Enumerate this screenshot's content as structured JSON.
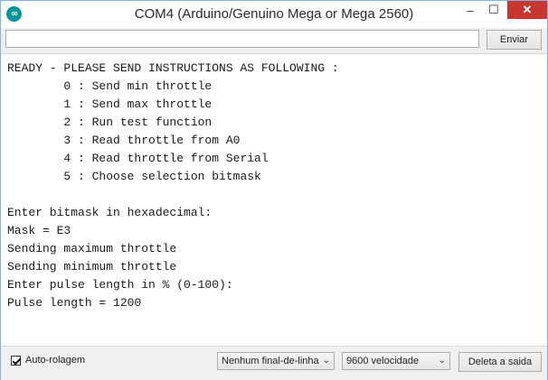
{
  "window": {
    "title": "COM4 (Arduino/Genuino Mega or Mega 2560)",
    "app_icon": "arduino-icon",
    "controls": {
      "minimize": "–",
      "maximize": "☐",
      "close": "✕"
    }
  },
  "input": {
    "value": "",
    "send_label": "Enviar"
  },
  "console": {
    "lines": [
      "READY - PLEASE SEND INSTRUCTIONS AS FOLLOWING :",
      "        0 : Send min throttle",
      "        1 : Send max throttle",
      "        2 : Run test function",
      "        3 : Read throttle from A0",
      "        4 : Read throttle from Serial",
      "        5 : Choose selection bitmask",
      "",
      "Enter bitmask in hexadecimal:",
      "Mask = E3",
      "Sending maximum throttle",
      "Sending minimum throttle",
      "Enter pulse length in % (0-100):",
      "Pulse length = 1200"
    ]
  },
  "status": {
    "autoscroll_label": "Auto-rolagem",
    "autoscroll_checked": true,
    "line_ending": "Nenhum final-de-linha",
    "baud": "9600 velocidade",
    "clear_label": "Deleta a saida",
    "chevron": "⌄"
  },
  "colors": {
    "accent": "#00979c",
    "close": "#c7372f",
    "window_border": "#7eb4ea"
  }
}
